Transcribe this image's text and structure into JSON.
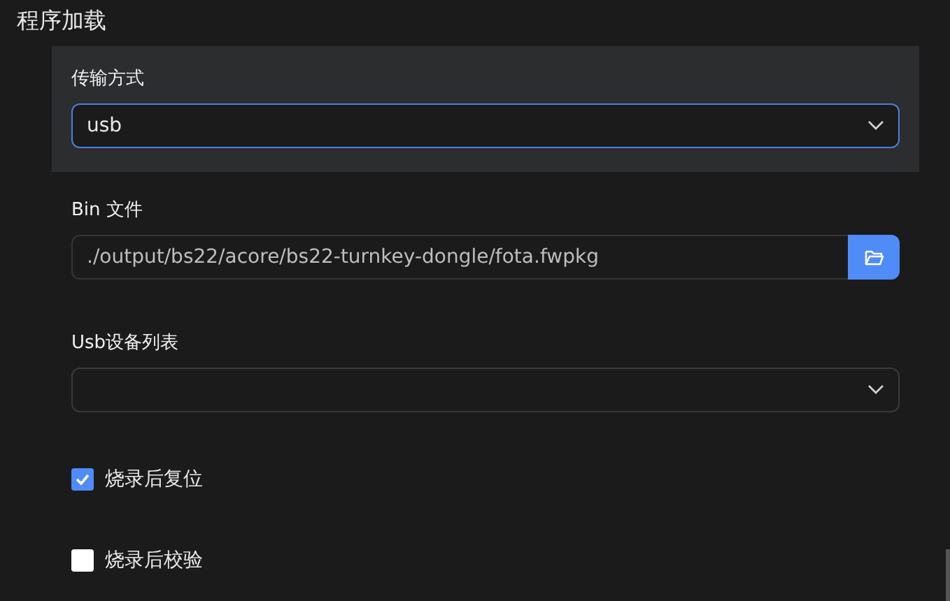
{
  "section_title": "程序加载",
  "transfer": {
    "label": "传输方式",
    "value": "usb",
    "focused": true
  },
  "bin_file": {
    "label": "Bin 文件",
    "value": "./output/bs22/acore/bs22-turnkey-dongle/fota.fwpkg"
  },
  "usb_devices": {
    "label": "Usb设备列表",
    "focused": false
  },
  "options": [
    {
      "label": "烧录后复位",
      "checked": true
    },
    {
      "label": "烧录后校验",
      "checked": false
    }
  ]
}
